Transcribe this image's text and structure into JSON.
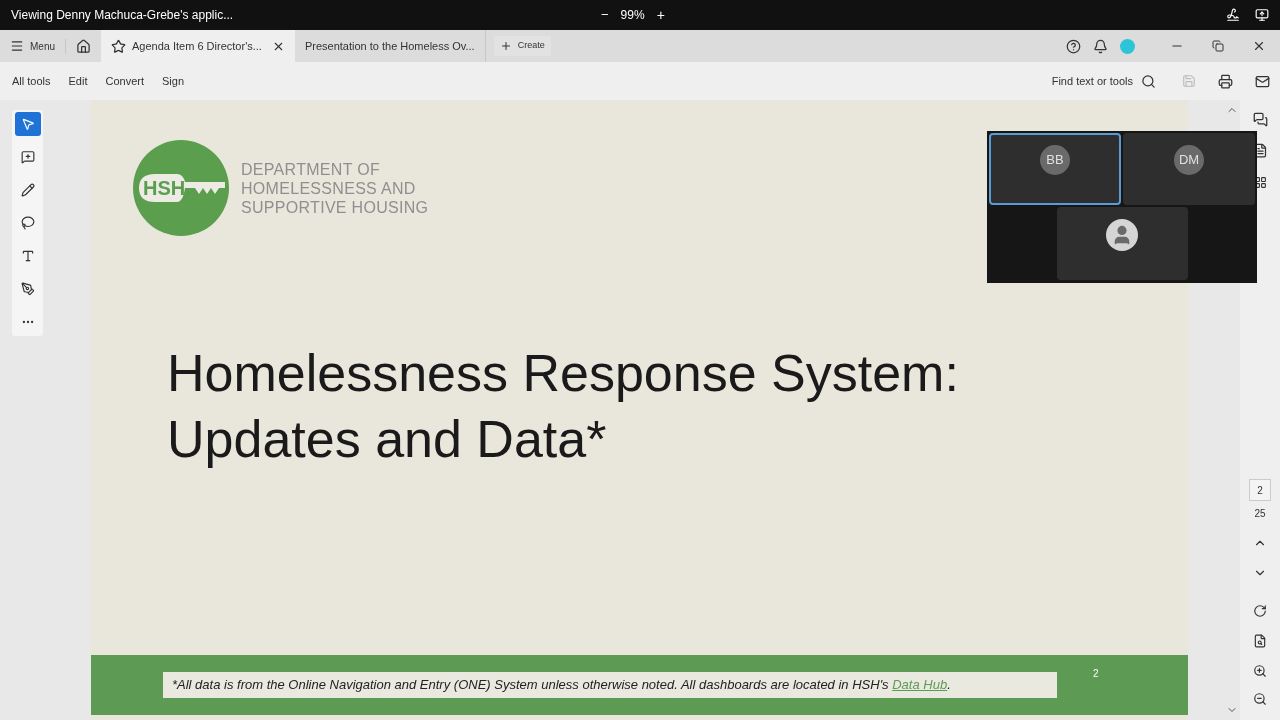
{
  "share_bar": {
    "title": "Viewing Denny Machuca-Grebe's applic...",
    "zoom_out": "−",
    "zoom": "99%",
    "zoom_in": "+"
  },
  "tab_bar": {
    "menu": "Menu",
    "tabs": [
      {
        "label": "Agenda Item 6 Director's...",
        "selected": true,
        "starred": true
      },
      {
        "label": "Presentation to the Homeless Ov...",
        "selected": false,
        "starred": false
      }
    ],
    "create": "Create"
  },
  "toolbar": {
    "items": [
      "All tools",
      "Edit",
      "Convert",
      "Sign"
    ],
    "search": "Find text or tools",
    "save_disabled": true
  },
  "tools": [
    {
      "kind": "select",
      "selected": true
    },
    {
      "kind": "comment",
      "selected": false
    },
    {
      "kind": "draw",
      "selected": false
    },
    {
      "kind": "lasso",
      "selected": false
    },
    {
      "kind": "textbox",
      "selected": false
    },
    {
      "kind": "sign",
      "selected": false
    },
    {
      "kind": "more",
      "selected": false
    }
  ],
  "slide": {
    "logo": "HSH",
    "department": [
      "DEPARTMENT OF",
      "HOMELESSNESS AND",
      "SUPPORTIVE HOUSING"
    ],
    "title": [
      "Homelessness Response System:",
      "Updates and Data*"
    ],
    "footnote_before": "*All data is from the Online Navigation and Entry (ONE) System unless otherwise noted.  All dashboards are located in HSH's ",
    "footnote_link": "Data Hub",
    "footnote_after": ".",
    "slide_number": "2"
  },
  "video": [
    {
      "kind": "initials",
      "initials": "BB",
      "selected": true
    },
    {
      "kind": "initials",
      "initials": "DM",
      "selected": false
    },
    {
      "kind": "avatar",
      "selected": false
    }
  ],
  "page_nav": {
    "current": "2",
    "total": "25"
  }
}
